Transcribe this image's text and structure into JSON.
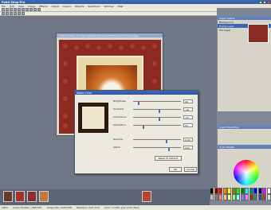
{
  "app": {
    "title": "Paint Shop Pro"
  },
  "menu": [
    "File",
    "Edit",
    "View",
    "Image",
    "Effects",
    "Adjust",
    "Layers",
    "Objects",
    "Selections",
    "Window",
    "Help"
  ],
  "document": {
    "title": "C:\\Documents and Settings\\Mark\\Desktop\\Photos\\red fox.pspimage"
  },
  "dialog": {
    "title": "Adjust Color",
    "sliders": [
      {
        "label": "Brightness",
        "value": "40",
        "level": 0.1
      },
      {
        "label": "Contrast",
        "value": "-16",
        "level": 0.55
      },
      {
        "label": "Luminance",
        "value": "-25",
        "level": 0.55
      },
      {
        "label": "Saturation",
        "value": "53",
        "level": 0.2
      },
      {
        "label": "Gamma",
        "value": "0.90",
        "level": 0.7
      },
      {
        "label": "Alpha",
        "value": "100",
        "level": 0.75
      }
    ],
    "reset_label": "Reset To Default",
    "ok_label": "OK",
    "cancel_label": "Cancel"
  },
  "layers_panel": {
    "title": "Layer Palette",
    "items": [
      "Background",
      "Frame Layer",
      "Fox Layer"
    ]
  },
  "history_panel": {
    "title": "Layer Properties"
  },
  "color_panel": {
    "title": "Color Palette"
  },
  "status": {
    "zoom": "100%",
    "cursor": "Cursor Position: (398,128)",
    "image": "Image Size: 1024x768",
    "selection": "Selection: (0,0) (0,0)",
    "pixel": "Color: (r=255, g=0, b=0) (Red)"
  }
}
